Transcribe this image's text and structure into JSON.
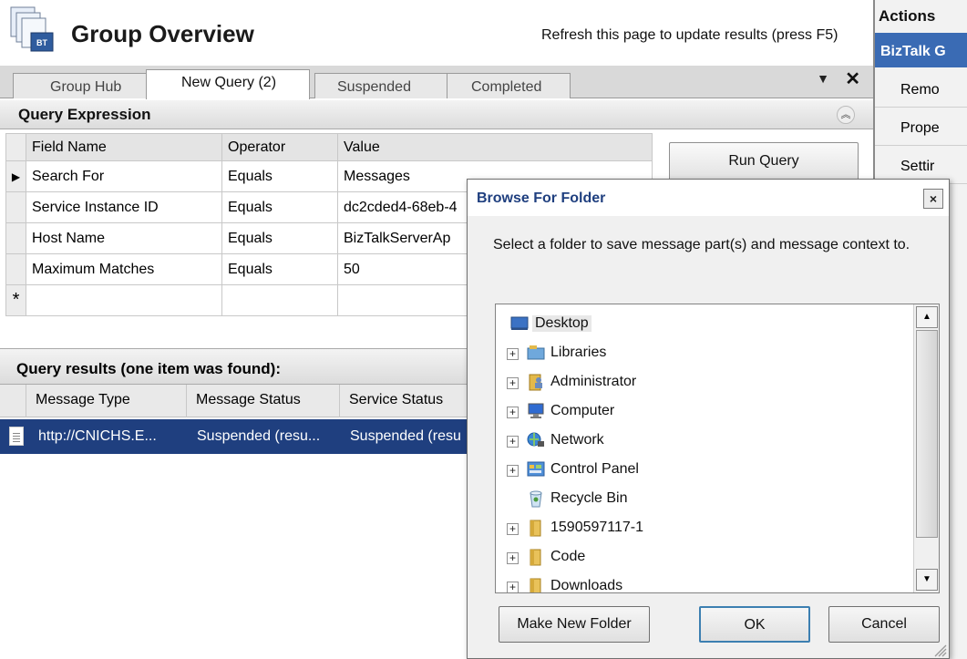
{
  "header": {
    "title": "Group Overview",
    "refresh_hint": "Refresh this page to update results (press F5)"
  },
  "tabs": [
    {
      "label": "Group Hub",
      "active": false
    },
    {
      "label": "New Query (2)",
      "active": true
    },
    {
      "label": "Suspended",
      "active": false
    },
    {
      "label": "Completed",
      "active": false
    }
  ],
  "query_expression": {
    "title": "Query Expression",
    "columns": [
      "Field Name",
      "Operator",
      "Value"
    ],
    "rows": [
      {
        "field": "Search For",
        "operator": "Equals",
        "value": "Messages"
      },
      {
        "field": "Service Instance ID",
        "operator": "Equals",
        "value": "dc2cded4-68eb-4"
      },
      {
        "field": "Host Name",
        "operator": "Equals",
        "value": "BizTalkServerAp"
      },
      {
        "field": "Maximum Matches",
        "operator": "Equals",
        "value": "50"
      }
    ],
    "new_row_marker": "*",
    "run_button": "Run Query"
  },
  "query_results": {
    "title": "Query results (one item was found):",
    "columns": [
      "Message Type",
      "Message Status",
      "Service Status"
    ],
    "rows": [
      {
        "message_type": "http://CNICHS.E...",
        "message_status": "Suspended (resu...",
        "service_status": "Suspended (resu"
      }
    ]
  },
  "actions": {
    "title": "Actions",
    "group": "BizTalk G",
    "items": [
      "Remo",
      "Prope",
      "Settir"
    ]
  },
  "dialog": {
    "title": "Browse For Folder",
    "close_label": "×",
    "description": "Select a folder to save message part(s) and message context to.",
    "tree": [
      {
        "label": "Desktop",
        "icon": "desktop-icon",
        "expander": false,
        "selected": true
      },
      {
        "label": "Libraries",
        "icon": "libraries-icon",
        "expander": true
      },
      {
        "label": "Administrator",
        "icon": "user-folder-icon",
        "expander": true
      },
      {
        "label": "Computer",
        "icon": "computer-icon",
        "expander": true
      },
      {
        "label": "Network",
        "icon": "network-icon",
        "expander": true
      },
      {
        "label": "Control Panel",
        "icon": "control-panel-icon",
        "expander": true
      },
      {
        "label": "Recycle Bin",
        "icon": "recycle-bin-icon",
        "expander": false
      },
      {
        "label": "1590597117-1",
        "icon": "folder-icon",
        "expander": true
      },
      {
        "label": "Code",
        "icon": "folder-icon",
        "expander": true
      },
      {
        "label": "Downloads",
        "icon": "folder-icon",
        "expander": true
      }
    ],
    "buttons": {
      "make_new_folder": "Make New Folder",
      "ok": "OK",
      "cancel": "Cancel"
    }
  },
  "colors": {
    "selection": "#1f3f7f",
    "actions_header": "#3a6bb4",
    "dialog_title": "#1f3f7f"
  }
}
